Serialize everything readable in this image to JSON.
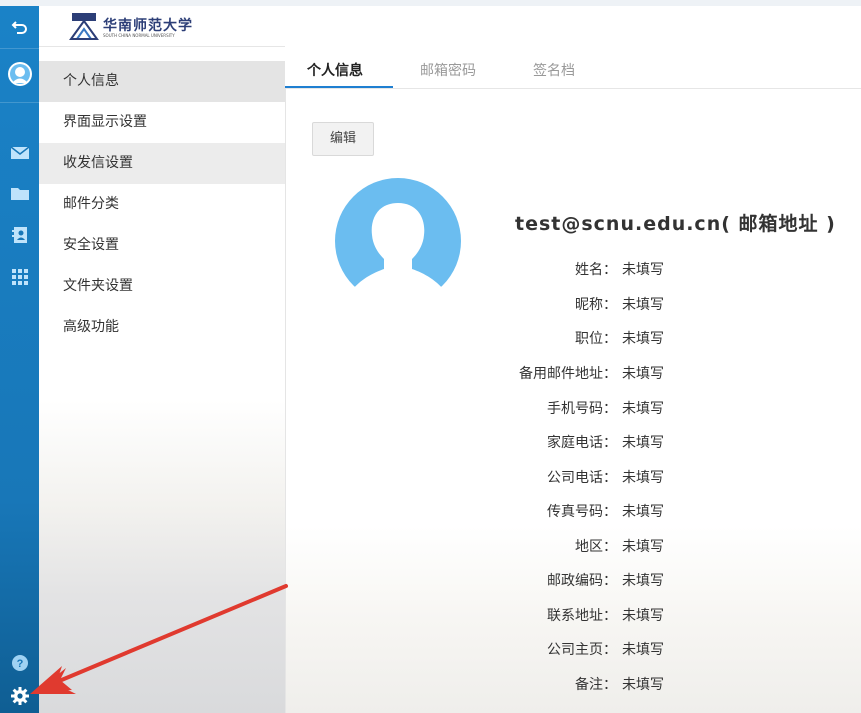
{
  "header": {
    "logo_text": "华南师范大学",
    "logo_subtext": "SOUTH CHINA NORMAL UNIVERSITY"
  },
  "nav": {
    "items": [
      {
        "label": "个人信息"
      },
      {
        "label": "界面显示设置"
      },
      {
        "label": "收发信设置"
      },
      {
        "label": "邮件分类"
      },
      {
        "label": "安全设置"
      },
      {
        "label": "文件夹设置"
      },
      {
        "label": "高级功能"
      }
    ]
  },
  "tabs": [
    {
      "label": "个人信息"
    },
    {
      "label": "邮箱密码"
    },
    {
      "label": "签名档"
    }
  ],
  "profile": {
    "edit_label": "编辑",
    "email_display": "test@scnu.edu.cn( 邮箱地址 )",
    "fields": [
      {
        "label": "姓名：",
        "value": "未填写"
      },
      {
        "label": "昵称：",
        "value": "未填写"
      },
      {
        "label": "职位：",
        "value": "未填写"
      },
      {
        "label": "备用邮件地址：",
        "value": "未填写"
      },
      {
        "label": "手机号码：",
        "value": "未填写"
      },
      {
        "label": "家庭电话：",
        "value": "未填写"
      },
      {
        "label": "公司电话：",
        "value": "未填写"
      },
      {
        "label": "传真号码：",
        "value": "未填写"
      },
      {
        "label": "地区：",
        "value": "未填写"
      },
      {
        "label": "邮政编码：",
        "value": "未填写"
      },
      {
        "label": "联系地址：",
        "value": "未填写"
      },
      {
        "label": "公司主页：",
        "value": "未填写"
      },
      {
        "label": "备注：",
        "value": "未填写"
      }
    ]
  },
  "rail_icons": [
    "back-icon",
    "user-avatar-icon",
    "mail-icon",
    "folder-icon",
    "contacts-icon",
    "apps-grid-icon",
    "help-icon",
    "gear-icon"
  ],
  "colors": {
    "rail_blue": "#1a82c7",
    "tab_active_underline": "#1f7fd1",
    "avatar_blue": "#6bbdf0",
    "annotation_red": "#e03a2f"
  }
}
